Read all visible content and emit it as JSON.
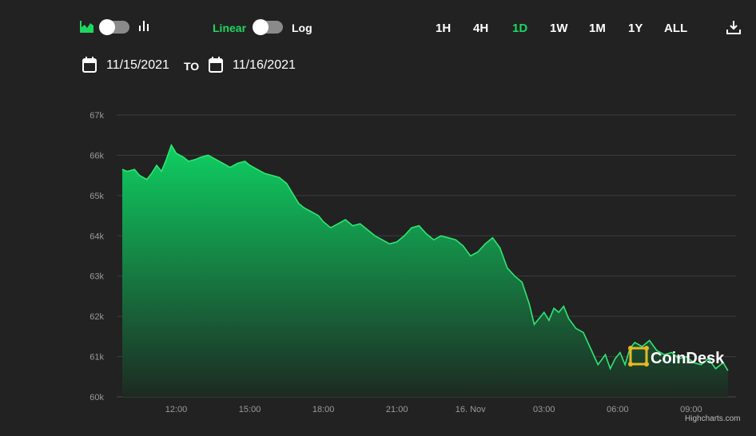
{
  "toolbar": {
    "chart_type_icons": [
      "area-chart-icon",
      "bar-chart-icon"
    ],
    "scale_linear_label": "Linear",
    "scale_log_label": "Log",
    "ranges": [
      "1H",
      "4H",
      "1D",
      "1W",
      "1M",
      "1Y",
      "ALL"
    ],
    "active_range": "1D",
    "download_icon": "download-icon"
  },
  "date_range": {
    "from": "11/15/2021",
    "to_label": "TO",
    "to": "11/16/2021",
    "calendar_icon": "calendar-icon"
  },
  "colors": {
    "background": "#222222",
    "accent": "#1ed760",
    "line": "#2ee872",
    "grid": "#3d3d3d",
    "area_top": "#0fcf62",
    "area_bottom": "#1d2a22"
  },
  "watermark": {
    "text": "CoinDesk"
  },
  "credits": "Highcharts.com",
  "chart_data": {
    "type": "area",
    "y_ticks": [
      "60k",
      "61k",
      "62k",
      "63k",
      "64k",
      "65k",
      "66k",
      "67k"
    ],
    "ylim": [
      60000,
      67000
    ],
    "x_ticks": [
      "12:00",
      "15:00",
      "18:00",
      "21:00",
      "16. Nov",
      "03:00",
      "06:00",
      "09:00"
    ],
    "x_tick_hours": [
      12,
      15,
      18,
      21,
      24,
      27,
      30,
      33
    ],
    "xlim": [
      9.8,
      34.6
    ],
    "grid": true,
    "series": [
      {
        "x": [
          9.8,
          10.0,
          10.3,
          10.5,
          10.8,
          11.0,
          11.2,
          11.4,
          11.6,
          11.8,
          12.0,
          12.3,
          12.5,
          12.8,
          13.0,
          13.3,
          13.6,
          13.9,
          14.2,
          14.5,
          14.8,
          15.0,
          15.3,
          15.6,
          15.9,
          16.2,
          16.5,
          16.8,
          17.0,
          17.2,
          17.5,
          17.8,
          18.0,
          18.3,
          18.6,
          18.9,
          19.2,
          19.5,
          19.8,
          20.1,
          20.4,
          20.7,
          21.0,
          21.3,
          21.6,
          21.9,
          22.2,
          22.5,
          22.8,
          23.1,
          23.4,
          23.7,
          24.0,
          24.3,
          24.6,
          24.9,
          25.2,
          25.5,
          25.8,
          26.1,
          26.4,
          26.6,
          26.8,
          27.0,
          27.2,
          27.4,
          27.6,
          27.8,
          28.0,
          28.3,
          28.6,
          28.9,
          29.2,
          29.5,
          29.7,
          29.9,
          30.1,
          30.3,
          30.5,
          30.7,
          31.0,
          31.3,
          31.6,
          31.9,
          32.2,
          32.5,
          32.8,
          33.1,
          33.4,
          33.7,
          34.0,
          34.3,
          34.5
        ],
        "values": [
          65650,
          65600,
          65650,
          65500,
          65400,
          65550,
          65750,
          65600,
          65900,
          66250,
          66050,
          65950,
          65850,
          65900,
          65950,
          66000,
          65900,
          65800,
          65700,
          65800,
          65850,
          65750,
          65650,
          65550,
          65500,
          65450,
          65300,
          65000,
          64800,
          64700,
          64600,
          64500,
          64350,
          64200,
          64300,
          64400,
          64250,
          64300,
          64150,
          64000,
          63900,
          63800,
          63850,
          64000,
          64200,
          64250,
          64050,
          63900,
          64000,
          63950,
          63900,
          63750,
          63500,
          63600,
          63800,
          63950,
          63700,
          63200,
          63000,
          62850,
          62300,
          61800,
          61950,
          62100,
          61900,
          62200,
          62100,
          62250,
          61950,
          61700,
          61600,
          61200,
          60800,
          61050,
          60700,
          60950,
          61100,
          60800,
          61200,
          61350,
          61250,
          61400,
          61150,
          61050,
          61100,
          60950,
          61000,
          60850,
          60800,
          60950,
          60700,
          60850,
          60650
        ]
      }
    ]
  }
}
